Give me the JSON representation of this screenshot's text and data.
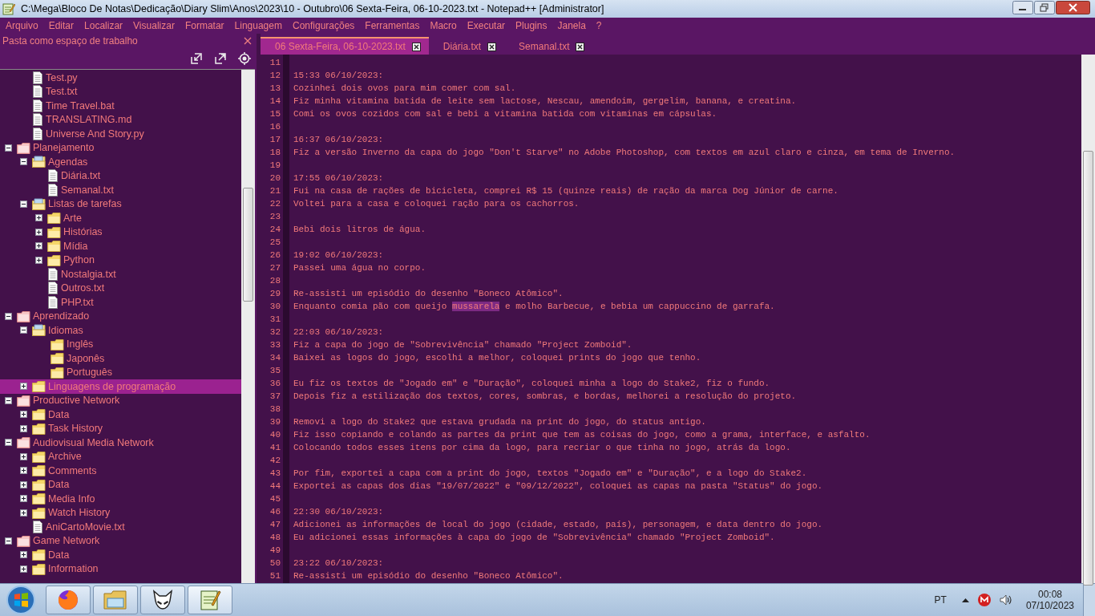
{
  "window": {
    "title": "C:\\Mega\\Bloco De Notas\\Dedicação\\Diary Slim\\Anos\\2023\\10 - Outubro\\06 Sexta-Feira, 06-10-2023.txt - Notepad++ [Administrator]"
  },
  "menu": [
    "Arquivo",
    "Editar",
    "Localizar",
    "Visualizar",
    "Formatar",
    "Linguagem",
    "Configurações",
    "Ferramentas",
    "Macro",
    "Executar",
    "Plugins",
    "Janela",
    "?"
  ],
  "panel": {
    "title": "Pasta como espaço de trabalho"
  },
  "tree": [
    {
      "kind": "continuation",
      "children": [
        {
          "kind": "file",
          "label": "Test.py",
          "selected": false
        },
        {
          "kind": "file",
          "label": "Test.txt",
          "selected": false
        },
        {
          "kind": "file",
          "label": "Time Travel.bat",
          "selected": false
        },
        {
          "kind": "file",
          "label": "TRANSLATING.md",
          "selected": false
        },
        {
          "kind": "file",
          "label": "Universe And Story.py",
          "selected": false
        }
      ]
    },
    {
      "kind": "root",
      "label": "Planejamento",
      "expanded": true,
      "selected": false,
      "children": [
        {
          "kind": "folder",
          "label": "Agendas",
          "expanded": true,
          "selected": false,
          "children": [
            {
              "kind": "file",
              "label": "Diária.txt",
              "selected": false
            },
            {
              "kind": "file",
              "label": "Semanal.txt",
              "selected": false
            }
          ]
        },
        {
          "kind": "folder",
          "label": "Listas de tarefas",
          "expanded": true,
          "selected": false,
          "children": [
            {
              "kind": "folder",
              "label": "Arte",
              "expanded": false,
              "selected": false
            },
            {
              "kind": "folder",
              "label": "Histórias",
              "expanded": false,
              "selected": false
            },
            {
              "kind": "folder",
              "label": "Mídia",
              "expanded": false,
              "selected": false
            },
            {
              "kind": "folder",
              "label": "Python",
              "expanded": false,
              "selected": false
            },
            {
              "kind": "file",
              "label": "Nostalgia.txt",
              "selected": false
            },
            {
              "kind": "file",
              "label": "Outros.txt",
              "selected": false
            },
            {
              "kind": "file",
              "label": "PHP.txt",
              "selected": false
            }
          ]
        }
      ]
    },
    {
      "kind": "root",
      "label": "Aprendizado",
      "expanded": true,
      "selected": false,
      "children": [
        {
          "kind": "folder",
          "label": "Idiomas",
          "expanded": true,
          "selected": false,
          "children": [
            {
              "kind": "leaf",
              "label": "Inglês",
              "selected": false
            },
            {
              "kind": "leaf",
              "label": "Japonês",
              "selected": false
            },
            {
              "kind": "leaf",
              "label": "Português",
              "selected": false
            }
          ]
        },
        {
          "kind": "folder",
          "label": "Linguagens de programação",
          "expanded": false,
          "selected": true
        }
      ]
    },
    {
      "kind": "root",
      "label": "Productive Network",
      "expanded": true,
      "selected": false,
      "children": [
        {
          "kind": "folder",
          "label": "Data",
          "expanded": false,
          "selected": false
        },
        {
          "kind": "folder",
          "label": "Task History",
          "expanded": false,
          "selected": false
        }
      ]
    },
    {
      "kind": "root",
      "label": "Audiovisual Media Network",
      "expanded": true,
      "selected": false,
      "children": [
        {
          "kind": "folder",
          "label": "Archive",
          "expanded": false,
          "selected": false
        },
        {
          "kind": "folder",
          "label": "Comments",
          "expanded": false,
          "selected": false
        },
        {
          "kind": "folder",
          "label": "Data",
          "expanded": false,
          "selected": false
        },
        {
          "kind": "folder",
          "label": "Media Info",
          "expanded": false,
          "selected": false
        },
        {
          "kind": "folder",
          "label": "Watch History",
          "expanded": false,
          "selected": false
        },
        {
          "kind": "file",
          "label": "AniCartoMovie.txt",
          "selected": false
        }
      ]
    },
    {
      "kind": "root",
      "label": "Game Network",
      "expanded": true,
      "selected": false,
      "children": [
        {
          "kind": "folder",
          "label": "Data",
          "expanded": false,
          "selected": false
        },
        {
          "kind": "folder",
          "label": "Information",
          "expanded": false,
          "selected": false
        }
      ]
    }
  ],
  "tabs": [
    {
      "label": "06 Sexta-Feira, 06-10-2023.txt",
      "selected": true
    },
    {
      "label": "Diária.txt",
      "selected": false
    },
    {
      "label": "Semanal.txt",
      "selected": false
    }
  ],
  "lines": [
    {
      "number": "11"
    },
    {
      "number": "12",
      "text": "15:33 06/10/2023:"
    },
    {
      "number": "13",
      "text": "Cozinhei dois ovos para mim comer com sal."
    },
    {
      "number": "14",
      "text": "Fiz minha vitamina batida de leite sem lactose, Nescau, amendoim, gergelim, banana, e creatina."
    },
    {
      "number": "15",
      "text": "Comi os ovos cozidos com sal e bebi a vitamina batida com vitaminas em cápsulas."
    },
    {
      "number": "16"
    },
    {
      "number": "17",
      "text": "16:37 06/10/2023:"
    },
    {
      "number": "18",
      "text": "Fiz a versão Inverno da capa do jogo \"Don't Starve\" no Adobe Photoshop, com textos em azul claro e cinza, em tema de Inverno."
    },
    {
      "number": "19"
    },
    {
      "number": "20",
      "text": "17:55 06/10/2023:"
    },
    {
      "number": "21",
      "text": "Fui na casa de rações de bicicleta, comprei R$ 15 (quinze reais) de ração da marca Dog Júnior de carne."
    },
    {
      "number": "22",
      "text": "Voltei para a casa e coloquei ração para os cachorros."
    },
    {
      "number": "23"
    },
    {
      "number": "24",
      "text": "Bebi dois litros de água."
    },
    {
      "number": "25"
    },
    {
      "number": "26",
      "text": "19:02 06/10/2023:"
    },
    {
      "number": "27",
      "text": "Passei uma água no corpo."
    },
    {
      "number": "28"
    },
    {
      "number": "29",
      "text": "Re-assisti um episódio do desenho \"Boneco Atômico\"."
    },
    {
      "number": "30",
      "segments": [
        {
          "text": "Enquanto comia pão com queijo ",
          "highlighted": false
        },
        {
          "text": "mussarela",
          "highlighted": true
        },
        {
          "text": " e molho Barbecue, e bebia um cappuccino de garrafa.",
          "highlighted": false
        }
      ]
    },
    {
      "number": "31"
    },
    {
      "number": "32",
      "text": "22:03 06/10/2023:"
    },
    {
      "number": "33",
      "text": "Fiz a capa do jogo de \"Sobrevivência\" chamado \"Project Zomboid\"."
    },
    {
      "number": "34",
      "text": "Baixei as logos do jogo, escolhi a melhor, coloquei prints do jogo que tenho."
    },
    {
      "number": "35"
    },
    {
      "number": "36",
      "text": "Eu fiz os textos de \"Jogado em\" e \"Duração\", coloquei minha a logo do Stake2, fiz o fundo."
    },
    {
      "number": "37",
      "text": "Depois fiz a estilização dos textos, cores, sombras, e bordas, melhorei a resolução do projeto."
    },
    {
      "number": "38"
    },
    {
      "number": "39",
      "text": "Removi a logo do Stake2 que estava grudada na print do jogo, do status antigo."
    },
    {
      "number": "40",
      "text": "Fiz isso copiando e colando as partes da print que tem as coisas do jogo, como a grama, interface, e asfalto."
    },
    {
      "number": "41",
      "text": "Colocando todos esses itens por cima da logo, para recriar o que tinha no jogo, atrás da logo."
    },
    {
      "number": "42"
    },
    {
      "number": "43",
      "text": "Por fim, exportei a capa com a print do jogo, textos \"Jogado em\" e \"Duração\", e a logo do Stake2."
    },
    {
      "number": "44",
      "text": "Exportei as capas dos dias \"19/07/2022\" e \"09/12/2022\", coloquei as capas na pasta \"Status\" do jogo."
    },
    {
      "number": "45"
    },
    {
      "number": "46",
      "text": "22:30 06/10/2023:"
    },
    {
      "number": "47",
      "text": "Adicionei as informações de local do jogo (cidade, estado, país), personagem, e data dentro do jogo."
    },
    {
      "number": "48",
      "text": "Eu adicionei essas informações à capa do jogo de \"Sobrevivência\" chamado \"Project Zomboid\"."
    },
    {
      "number": "49"
    },
    {
      "number": "50",
      "text": "23:22 06/10/2023:"
    },
    {
      "number": "51",
      "text": "Re-assisti um episódio do desenho \"Boneco Atômico\"."
    }
  ],
  "taskbar": {
    "language": "PT",
    "time": "00:08",
    "date": "07/10/2023"
  }
}
